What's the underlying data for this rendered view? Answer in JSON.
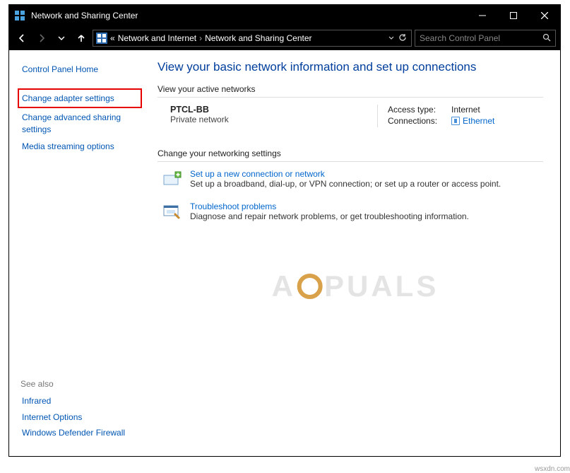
{
  "window": {
    "title": "Network and Sharing Center"
  },
  "breadcrumb": {
    "truncate": "«",
    "parent": "Network and Internet",
    "current": "Network and Sharing Center"
  },
  "search": {
    "placeholder": "Search Control Panel"
  },
  "sidebar": {
    "home": "Control Panel Home",
    "links": [
      "Change adapter settings",
      "Change advanced sharing settings",
      "Media streaming options"
    ],
    "see_also_head": "See also",
    "see_also": [
      "Infrared",
      "Internet Options",
      "Windows Defender Firewall"
    ]
  },
  "main": {
    "heading": "View your basic network information and set up connections",
    "active_head": "View your active networks",
    "network": {
      "name": "PTCL-BB",
      "desc": "Private network",
      "access_label": "Access type:",
      "access_value": "Internet",
      "conn_label": "Connections:",
      "conn_value": "Ethernet"
    },
    "change_head": "Change your networking settings",
    "items": [
      {
        "title": "Set up a new connection or network",
        "desc": "Set up a broadband, dial-up, or VPN connection; or set up a router or access point."
      },
      {
        "title": "Troubleshoot problems",
        "desc": "Diagnose and repair network problems, or get troubleshooting information."
      }
    ]
  },
  "footer": "wsxdn.com"
}
